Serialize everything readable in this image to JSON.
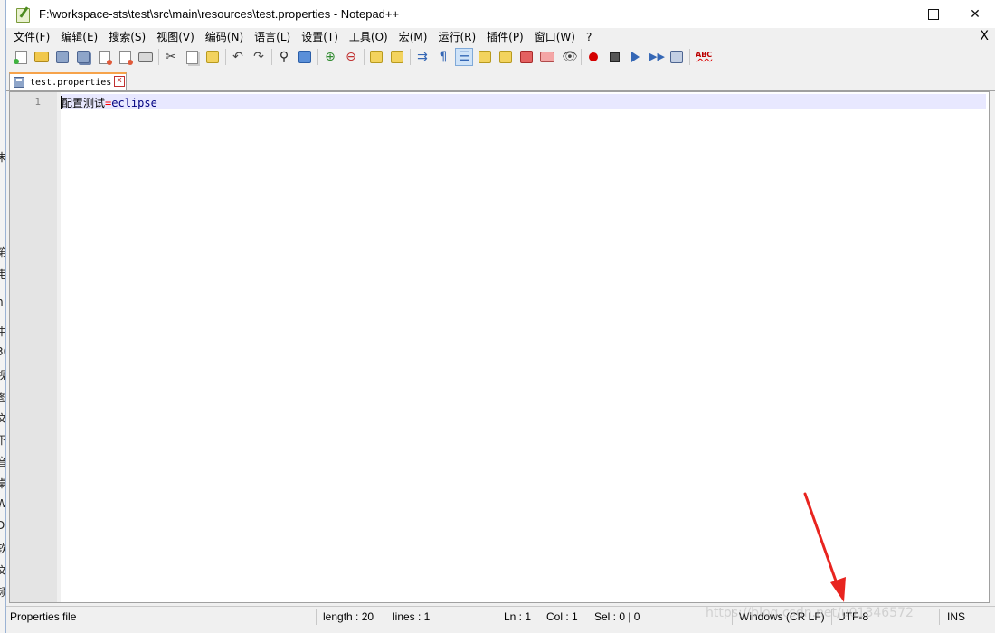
{
  "window": {
    "title": "F:\\workspace-sts\\test\\src\\main\\resources\\test.properties - Notepad++",
    "controls": {
      "minimize": "—",
      "maximize": "☐",
      "close": "✕"
    }
  },
  "menu": {
    "items": [
      "文件(F)",
      "编辑(E)",
      "搜索(S)",
      "视图(V)",
      "编码(N)",
      "语言(L)",
      "设置(T)",
      "工具(O)",
      "宏(M)",
      "运行(R)",
      "插件(P)",
      "窗口(W)",
      "?"
    ],
    "close_label": "X"
  },
  "tabs": [
    {
      "label": "test.properties",
      "close": "x"
    }
  ],
  "editor": {
    "line_number": "1",
    "code": {
      "key": "配置测试",
      "eq": "=",
      "value": "eclipse"
    }
  },
  "status": {
    "file_type": "Properties file",
    "length": "length : 20",
    "lines": "lines : 1",
    "ln": "Ln : 1",
    "col": "Col : 1",
    "sel": "Sel : 0 | 0",
    "eol": "Windows (CR LF)",
    "encoding": "UTF-8",
    "mode": "INS"
  },
  "watermark": "https://blog.csdn.net/u01346572",
  "background_text": [
    "未",
    "第",
    "电",
    "n",
    "中",
    "30",
    "视",
    "图",
    "文",
    "下",
    "音",
    "桌",
    "W",
    "D",
    "软",
    "文",
    "频"
  ],
  "colors": {
    "annotation_arrow": "#e8241f",
    "tab_accent": "#f6a34b",
    "current_line": "#e8e8ff",
    "equals_sign": "#ff0000",
    "value_text": "#000080"
  }
}
